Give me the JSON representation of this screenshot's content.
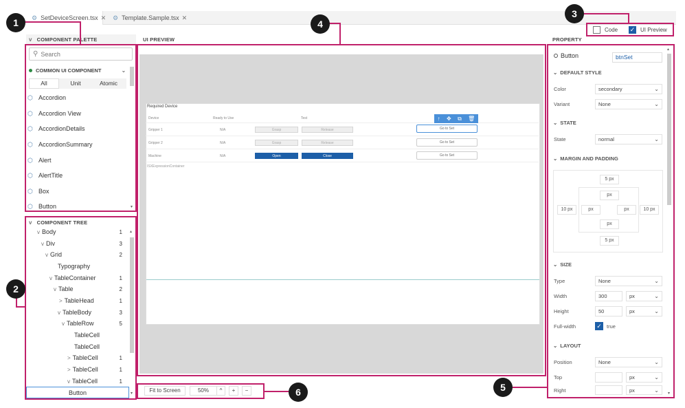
{
  "tabs": [
    {
      "label": "SetDeviceScreen.tsx",
      "close": "✕"
    },
    {
      "label": "Template.Sample.tsx",
      "close": "✕"
    }
  ],
  "view_toggle": {
    "code_label": "Code",
    "code_checked": false,
    "preview_label": "UI Preview",
    "preview_checked": true
  },
  "palette": {
    "header": "COMPONENT PALETTE",
    "search_placeholder": "Search",
    "category": "COMMON UI COMPONENT",
    "filters": [
      "All",
      "Unit",
      "Atomic"
    ],
    "items": [
      "Accordion",
      "Accordion View",
      "AccordionDetails",
      "AccordionSummary",
      "Alert",
      "AlertTitle",
      "Box",
      "Button"
    ]
  },
  "tree": {
    "header": "COMPONENT TREE",
    "rows": [
      {
        "label": "Body",
        "count": "1",
        "chev": "v"
      },
      {
        "label": "Div",
        "count": "3",
        "chev": "v"
      },
      {
        "label": "Grid",
        "count": "2",
        "chev": "v"
      },
      {
        "label": "Typography",
        "count": "",
        "chev": ""
      },
      {
        "label": "TableContainer",
        "count": "1",
        "chev": "v"
      },
      {
        "label": "Table",
        "count": "2",
        "chev": "v"
      },
      {
        "label": "TableHead",
        "count": "1",
        "chev": ">"
      },
      {
        "label": "TableBody",
        "count": "3",
        "chev": "v"
      },
      {
        "label": "TableRow",
        "count": "5",
        "chev": "v"
      },
      {
        "label": "TableCell",
        "count": "",
        "chev": ""
      },
      {
        "label": "TableCell",
        "count": "",
        "chev": ""
      },
      {
        "label": "TableCell",
        "count": "1",
        "chev": ">"
      },
      {
        "label": "TableCell",
        "count": "1",
        "chev": ">"
      },
      {
        "label": "TableCell",
        "count": "1",
        "chev": "v"
      },
      {
        "label": "Button",
        "count": "",
        "chev": ""
      }
    ]
  },
  "preview": {
    "header": "UI PREVIEW",
    "section_title": "Required Device",
    "columns": [
      "Device",
      "Ready to Use",
      "Test"
    ],
    "rows": [
      {
        "device": "Gripper 1",
        "ready": "N/A",
        "b1": "Grasp",
        "b2": "Release",
        "b1_on": false,
        "goto": "Go to Set"
      },
      {
        "device": "Gripper 2",
        "ready": "N/A",
        "b1": "Grasp",
        "b2": "Release",
        "b1_on": false,
        "goto": "Go to Set"
      },
      {
        "device": "Machine",
        "ready": "N/A",
        "b1": "Open",
        "b2": "Close",
        "b1_on": true,
        "goto": "Go to Set"
      }
    ],
    "footer_tag": "ISXExpressionContainer",
    "toolbar_icons": [
      "↑",
      "✥",
      "⧉",
      "🗑"
    ]
  },
  "zoom": {
    "fit_label": "Fit to Screen",
    "value": "50%",
    "up": "^",
    "plus": "+",
    "minus": "−"
  },
  "property": {
    "header": "PROPERTY",
    "component_type": "Button",
    "component_id": "btnSet",
    "default_style": {
      "title": "DEFAULT STYLE",
      "color_label": "Color",
      "color_value": "secondary",
      "variant_label": "Variant",
      "variant_value": "None"
    },
    "state": {
      "title": "STATE",
      "label": "State",
      "value": "normal"
    },
    "margin": {
      "title": "MARGIN AND PADDING",
      "top": "5 px",
      "bottom": "5 px",
      "left": "10 px",
      "right": "10 px",
      "pad_top": "px",
      "pad_bottom": "px",
      "pad_left": "px",
      "pad_right": "px"
    },
    "size": {
      "title": "SIZE",
      "type_label": "Type",
      "type_value": "None",
      "width_label": "Width",
      "width_value": "300",
      "width_unit": "px",
      "height_label": "Height",
      "height_value": "50",
      "height_unit": "px",
      "fullwidth_label": "Full-width",
      "fullwidth_value": "true"
    },
    "layout": {
      "title": "LAYOUT",
      "position_label": "Position",
      "position_value": "None",
      "top_label": "Top",
      "top_unit": "px",
      "right_label": "Right",
      "right_unit": "px"
    }
  },
  "callouts": [
    "1",
    "2",
    "3",
    "4",
    "5",
    "6"
  ],
  "colors": {
    "highlight": "#c0206a",
    "accent": "#1d5fa8",
    "selection": "#4a90d9"
  }
}
